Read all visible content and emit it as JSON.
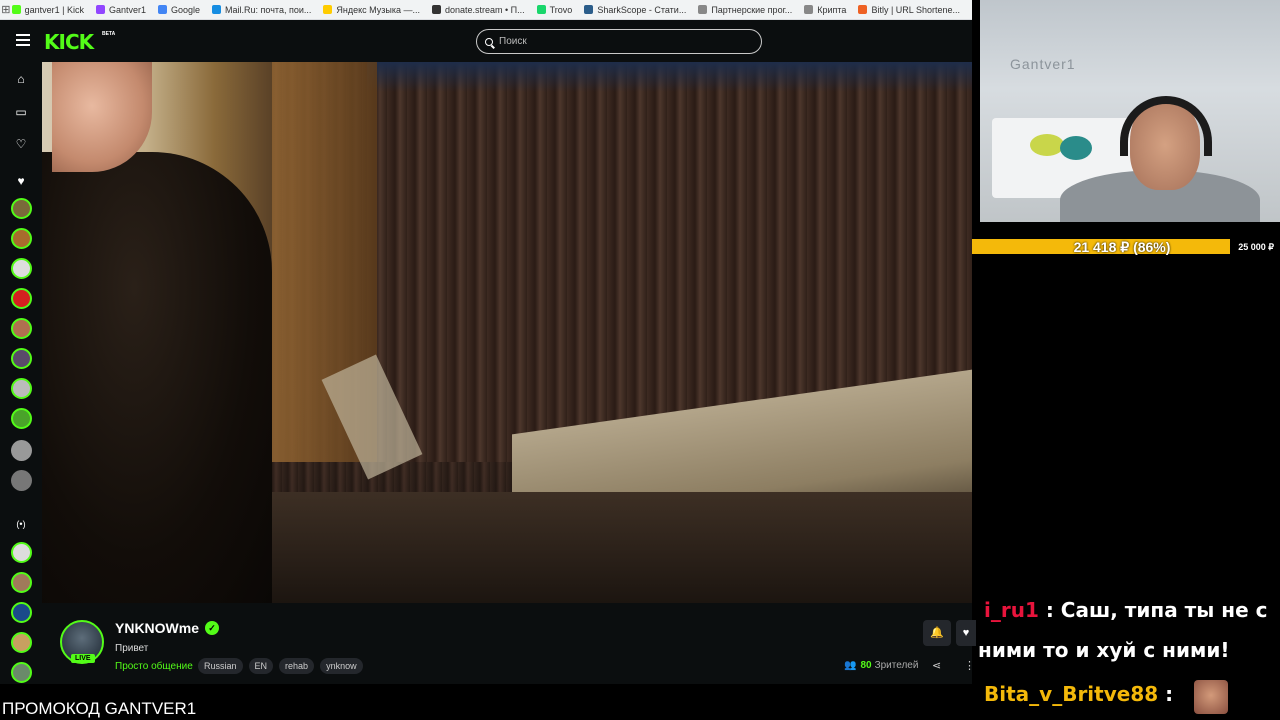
{
  "bookmarks": [
    {
      "label": "gantver1 | Kick",
      "color": "#53fc18"
    },
    {
      "label": "Gantver1",
      "color": "#9146ff"
    },
    {
      "label": "Google",
      "color": "#4285f4"
    },
    {
      "label": "Mail.Ru: почта, пои...",
      "color": "#168de2"
    },
    {
      "label": "Яндекс Музыка —...",
      "color": "#ffcc00"
    },
    {
      "label": "donate.stream • П...",
      "color": "#333333"
    },
    {
      "label": "Trovo",
      "color": "#19d66b"
    },
    {
      "label": "SharkScope - Стати...",
      "color": "#2b5d8a"
    },
    {
      "label": "Партнерские прог...",
      "color": "#888888"
    },
    {
      "label": "Крипта",
      "color": "#888888"
    },
    {
      "label": "Bitly | URL Shortene...",
      "color": "#ee6123"
    }
  ],
  "header": {
    "logo": "KICK",
    "beta": "BETA",
    "search_placeholder": "Поиск"
  },
  "channel": {
    "name": "YNKNOWme",
    "live": "LIVE",
    "title": "Привет",
    "category": "Просто общение",
    "tags": [
      "Russian",
      "EN",
      "rehab",
      "ynknow"
    ],
    "viewers_count": "80",
    "viewers_label": "Зрителей"
  },
  "overlay": {
    "promo": "ПРОМОКОД GANTVER1",
    "webcam_logo": "Gantver1",
    "donation_text": "21 418 ₽ (86%)",
    "donation_goal": "25 000 ₽",
    "donation_progress": 0.86
  },
  "chat": [
    {
      "user": "i_ru1",
      "message": " : Саш, типа ты не с"
    },
    {
      "continuation": "ними то и хуй с ними!"
    },
    {
      "user": "Bita_v_Britve88",
      "message": " :"
    }
  ],
  "colors": {
    "accent": "#53fc18",
    "donation": "#f4b90a",
    "chat_user1": "#e8143c"
  }
}
